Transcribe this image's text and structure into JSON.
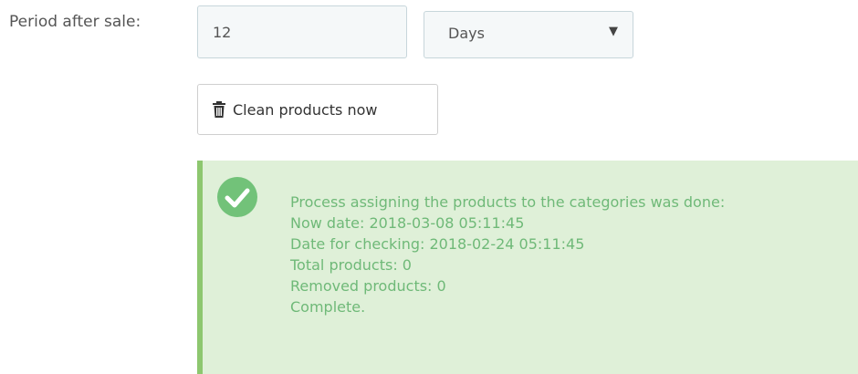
{
  "form": {
    "period_label": "Period after sale:",
    "period_value": "12",
    "unit_selected": "Days"
  },
  "actions": {
    "clean_label": "Clean products now"
  },
  "alert": {
    "lines": [
      "Process assigning the products to the categories was done:",
      "Now date: 2018-03-08 05:11:45",
      "Date for checking: 2018-02-24 05:11:45",
      "Total products: 0",
      "Removed products: 0",
      "Complete."
    ]
  },
  "colors": {
    "alert_bg": "#dff0d8",
    "alert_text": "#6fb978",
    "alert_border": "#8dc76f",
    "input_bg": "#f5f8f9"
  },
  "icons": {
    "button_icon": "trash-icon",
    "alert_icon": "check-circle-icon"
  }
}
